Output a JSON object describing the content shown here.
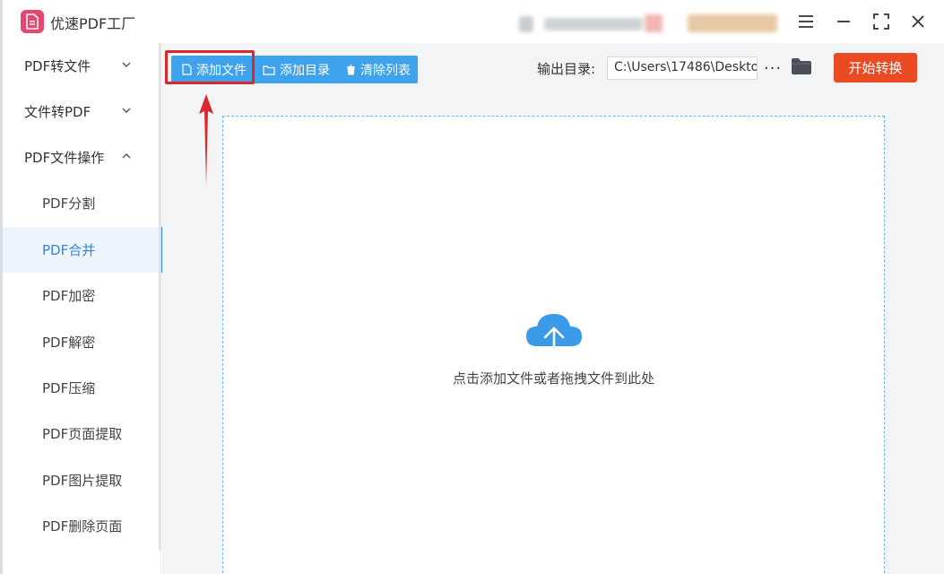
{
  "app": {
    "title": "优速PDF工厂"
  },
  "sidebar": {
    "groups": [
      {
        "label": "PDF转文件",
        "expanded": false
      },
      {
        "label": "文件转PDF",
        "expanded": false
      },
      {
        "label": "PDF文件操作",
        "expanded": true
      }
    ],
    "items": [
      {
        "label": "PDF分割"
      },
      {
        "label": "PDF合并",
        "active": true
      },
      {
        "label": "PDF加密"
      },
      {
        "label": "PDF解密"
      },
      {
        "label": "PDF压缩"
      },
      {
        "label": "PDF页面提取"
      },
      {
        "label": "PDF图片提取"
      },
      {
        "label": "PDF删除页面"
      }
    ]
  },
  "toolbar": {
    "add_file": "添加文件",
    "add_dir": "添加目录",
    "clear_list": "清除列表",
    "output_label": "输出目录:",
    "output_path": "C:\\Users\\17486\\Deskto",
    "more": "···",
    "start": "开始转换"
  },
  "dropzone": {
    "hint": "点击添加文件或者拖拽文件到此处"
  },
  "colors": {
    "accent": "#3ea2ec",
    "primary_blue": "#2f86dd",
    "start": "#eb4a22",
    "highlight": "#d9292b",
    "logo": "#e8456f"
  },
  "icons": [
    "file-icon",
    "folder-outline-icon",
    "trash-icon",
    "folder-icon",
    "cloud-upload-icon",
    "menu-icon",
    "minimize-icon",
    "fullscreen-icon",
    "close-icon",
    "chevron-down-icon",
    "chevron-up-icon"
  ]
}
